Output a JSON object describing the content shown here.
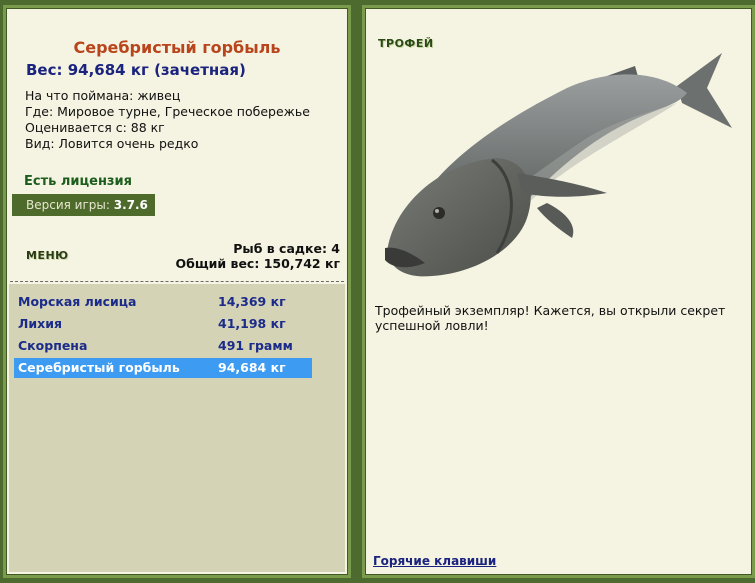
{
  "fish": {
    "name": "Серебристый горбыль",
    "weight_line": "Вес: 94,684 кг (зачетная)",
    "bait": "На что поймана: живец",
    "location": "Где: Мировое турне, Греческое побережье",
    "rated_from": "Оценивается с: 88 кг",
    "species": "Вид: Ловится очень редко"
  },
  "license": "Есть лицензия",
  "version": {
    "label": "Версия игры:",
    "value": "3.7.6"
  },
  "menu_label": "МЕНЮ",
  "cage": {
    "count_line": "Рыб в садке: 4",
    "total_line": "Общий вес: 150,742 кг"
  },
  "catch_list": [
    {
      "name": "Морская лисица",
      "weight": "14,369 кг",
      "selected": false
    },
    {
      "name": "Лихия",
      "weight": "41,198 кг",
      "selected": false
    },
    {
      "name": "Скорпена",
      "weight": "491 грамм",
      "selected": false
    },
    {
      "name": "Серебристый горбыль",
      "weight": "94,684 кг",
      "selected": true
    }
  ],
  "trophy": {
    "label": "ТРОФЕЙ",
    "description": "Трофейный экземпляр! Кажется, вы открыли секрет успешной ловли!",
    "image_icon": "fish-icon"
  },
  "hotkeys_link": "Горячие клавиши",
  "colors": {
    "selected_row": "#3d9cf2",
    "title": "#b8451b",
    "frame": "#4d6b2e"
  }
}
